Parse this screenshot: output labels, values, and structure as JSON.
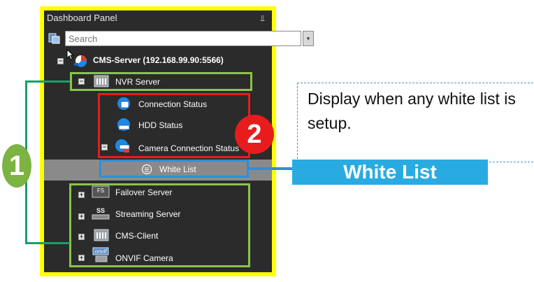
{
  "panel": {
    "title": "Dashboard Panel",
    "pin_glyph": "⫫"
  },
  "search": {
    "placeholder": "Search",
    "dropdown_glyph": "▾"
  },
  "tree": {
    "root": {
      "label": "CMS-Server (192.168.99.90:5566)"
    },
    "nvr": {
      "label": "NVR Server",
      "children": [
        {
          "label": "Connection Status"
        },
        {
          "label": "HDD Status"
        },
        {
          "label": "Camera Connection Status"
        }
      ],
      "white_list": "White List"
    },
    "others": [
      {
        "label": "Failover Server",
        "icon_text": "FS"
      },
      {
        "label": "Streaming Server",
        "icon_text": "SS"
      },
      {
        "label": "CMS-Client",
        "icon_text": ""
      },
      {
        "label": "ONVIF Camera",
        "icon_text": "onvif"
      }
    ]
  },
  "callout": {
    "text": "Display when any white list is setup.",
    "label": "White List",
    "accent": "#29abe2"
  },
  "markers": {
    "one": "1",
    "two": "2"
  },
  "colors": {
    "panel_border": "#ffff00",
    "green_box": "#8bc34a",
    "red_box": "#e81c1c",
    "blue_box": "#2e8fd8"
  }
}
